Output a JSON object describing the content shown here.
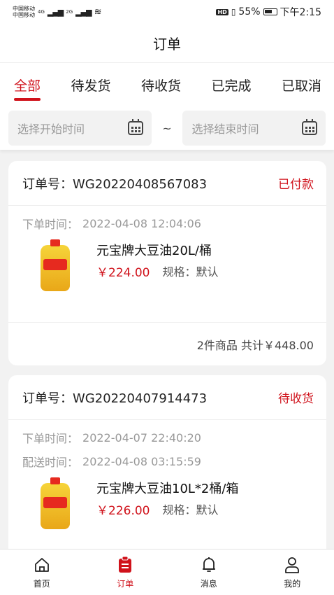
{
  "status_bar": {
    "carrier_1": "中国移动",
    "carrier_2": "中国移动",
    "net_1": "4G",
    "net_2": "2G",
    "hd": "HD",
    "battery": "55%",
    "time": "下午2:15"
  },
  "header": {
    "title": "订单"
  },
  "tabs": [
    {
      "label": "全部",
      "active": true
    },
    {
      "label": "待发货",
      "active": false
    },
    {
      "label": "待收货",
      "active": false
    },
    {
      "label": "已完成",
      "active": false
    },
    {
      "label": "已取消",
      "active": false
    }
  ],
  "date_filter": {
    "start_placeholder": "选择开始时间",
    "separator": "~",
    "end_placeholder": "选择结束时间"
  },
  "orders": [
    {
      "order_no_label": "订单号：",
      "order_no": "WG20220408567083",
      "status": "已付款",
      "order_time_label": "下单时间：",
      "order_time": "2022-04-08 12:04:06",
      "product": {
        "name": "元宝牌大豆油20L/桶",
        "price": "￥224.00",
        "spec_label": "规格：",
        "spec": "默认"
      },
      "summary": "2件商品 共计￥448.00"
    },
    {
      "order_no_label": "订单号：",
      "order_no": "WG20220407914473",
      "status": "待收货",
      "order_time_label": "下单时间：",
      "order_time": "2022-04-07 22:40:20",
      "delivery_time_label": "配送时间：",
      "delivery_time": "2022-04-08 03:15:59",
      "product": {
        "name": "元宝牌大豆油10L*2桶/箱",
        "price": "￥226.00",
        "spec_label": "规格：",
        "spec": "默认"
      }
    }
  ],
  "bottom_nav": [
    {
      "label": "首页",
      "icon": "home-icon",
      "active": false
    },
    {
      "label": "订单",
      "icon": "order-icon",
      "active": true
    },
    {
      "label": "消息",
      "icon": "bell-icon",
      "active": false
    },
    {
      "label": "我的",
      "icon": "user-icon",
      "active": false
    }
  ],
  "colors": {
    "accent": "#d0121b",
    "background": "#f2f2f2"
  }
}
